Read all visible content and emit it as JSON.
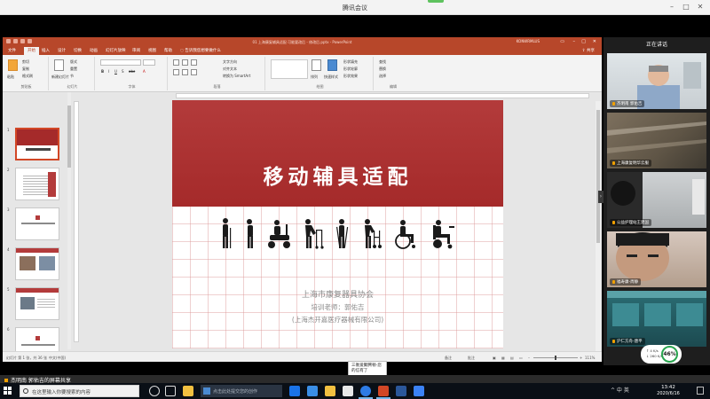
{
  "meeting": {
    "window_title": "腾讯会议",
    "speaking_label": "正在讲话",
    "share_status": "杰明南 郭佑吉的屏幕共享"
  },
  "ppt": {
    "file_title": "01 上海康复辅具适配 可能要改后 - 修改后.pptx - PowerPoint",
    "user_name": "KONWRMLUS",
    "tabs": [
      "文件",
      "开始",
      "插入",
      "设计",
      "切换",
      "动画",
      "幻灯片放映",
      "审阅",
      "视图",
      "帮助"
    ],
    "tell_me": "告诉我您想要做什么",
    "share_label": "共享",
    "ribbon": {
      "clipboard": {
        "label": "剪贴板",
        "paste": "粘贴",
        "cut": "剪切",
        "copy": "复制",
        "format_painter": "格式刷"
      },
      "slides": {
        "label": "幻灯片",
        "new_slide": "新建幻灯片",
        "layout": "版式",
        "reset": "重置",
        "section": "节"
      },
      "font": {
        "label": "字体"
      },
      "paragraph": {
        "label": "段落",
        "text_direction": "文字方向",
        "align_text": "对齐文本",
        "smartart": "转换为 SmartArt"
      },
      "drawing": {
        "label": "绘图",
        "arrange": "排列",
        "quick_styles": "快速样式",
        "shape_fill": "形状填充",
        "shape_outline": "形状轮廓",
        "shape_effects": "形状效果"
      },
      "editing": {
        "label": "编辑",
        "find": "查找",
        "replace": "替换",
        "select": "选择"
      }
    },
    "slide_numbers": [
      "1",
      "2",
      "3",
      "4",
      "5",
      "6",
      "7"
    ],
    "status": {
      "slide_count": "幻灯片 第 1 张，共 36 张",
      "language": "中文(中国)",
      "notes": "备注",
      "comments": "批注",
      "zoom": "111%"
    }
  },
  "slide": {
    "title": "移动辅具适配",
    "org": "上海市康复器具协会",
    "trainer": "培训老师：郭佑吉",
    "company": "(上海杰开嘉医疗器械有限公司)"
  },
  "participants": [
    {
      "name": "杰明南 郭佑吉"
    },
    {
      "name": "上海康复明华云服"
    },
    {
      "name": "公益护理站王建国"
    },
    {
      "name": "福寿康-周静"
    },
    {
      "name": "沪仁方舟-唐平"
    }
  ],
  "network": {
    "up": "4 K/s",
    "down": "260 K/s",
    "cpu": "46%"
  },
  "tooltip": {
    "text": "三衡爱聚腾顿-您的信有了"
  },
  "taskbar": {
    "search_placeholder": "在这里输入你要搜索的内容",
    "input_placeholder": "点击此处提交您的创作",
    "time": "13:42",
    "date": "2020/6/16",
    "tray_text": "^ 中 英"
  },
  "colors": {
    "accent": "#b7472a",
    "slide_red": "#a52a2a",
    "active_tab": "#b7472a"
  }
}
